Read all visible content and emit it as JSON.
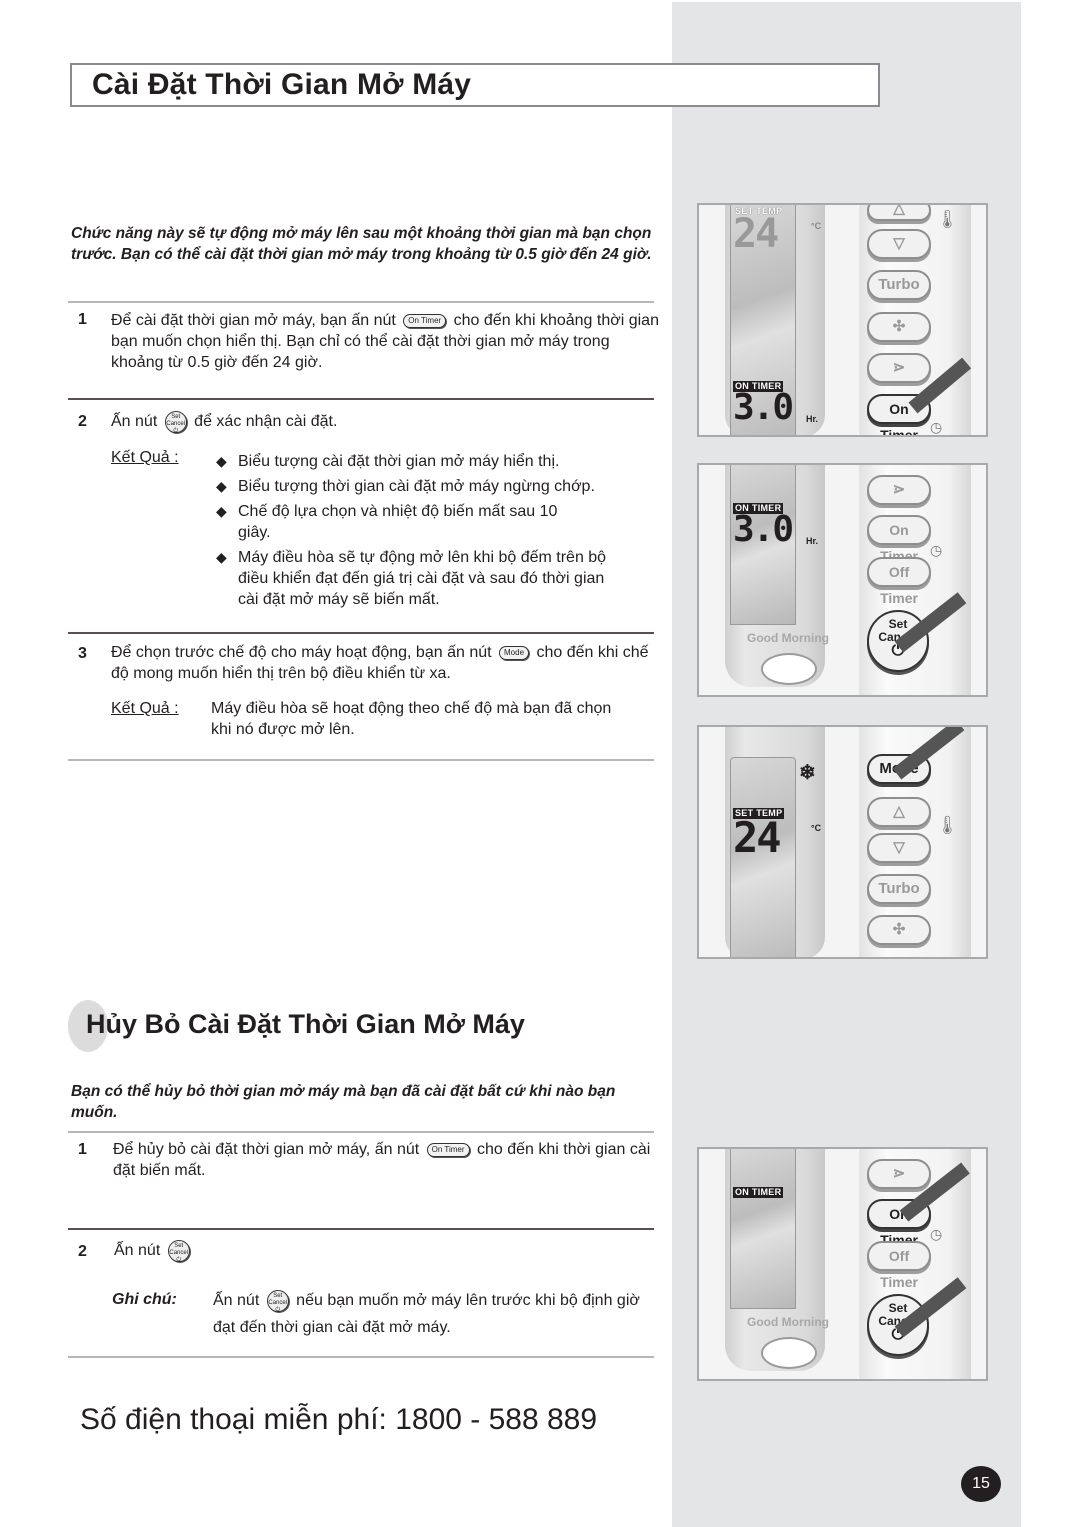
{
  "page": {
    "title": "Cài Đặt Thời Gian Mở Máy",
    "intro": "Chức năng này sẽ tự động mở máy lên sau một khoảng thời gian mà bạn chọn trước. Bạn có thể cài đặt thời gian mở máy trong khoảng từ 0.5 giờ đến 24 giờ.",
    "result_label": "Kết Quả",
    "result_colon": " :",
    "steps": [
      {
        "num": "1",
        "text_before": "Để cài đặt thời gian mở máy, bạn ấn nút",
        "button": "On Timer",
        "text_after": "cho đến khi khoảng thời gian bạn muốn chọn hiển thị. Bạn chỉ có thể cài đặt thời gian mở máy trong khoảng từ 0.5 giờ đến 24 giờ."
      },
      {
        "num": "2",
        "text_before": "Ấn nút",
        "button": "Set Cancel",
        "text_after": "để xác nhận cài đặt.",
        "results": [
          "Biểu tượng cài đặt thời gian mở máy hiển thị.",
          "Biểu tượng thời gian cài đặt mở máy ngừng chớp.",
          "Chế độ lựa chọn và nhiệt độ biến mất sau 10 giây.",
          "Máy điều hòa sẽ tự động mở lên khi bộ đếm trên bộ điều khiển đạt đến giá trị cài đặt và sau đó thời gian cài đặt mở máy sẽ biến mất."
        ]
      },
      {
        "num": "3",
        "text_before": "Để chọn trước chế độ cho máy hoạt động, bạn ấn nút",
        "button": "Mode",
        "text_after": "cho đến khi chế độ mong muốn hiển thị trên bộ điều khiển từ xa.",
        "result": "Máy điều hòa sẽ hoạt động theo chế độ mà bạn đã chọn khi nó được mở lên."
      }
    ]
  },
  "cancel_section": {
    "title": "Hủy Bỏ Cài Đặt Thời Gian Mở Máy",
    "intro": "Bạn có thể hủy bỏ thời gian mở máy mà bạn đã cài đặt bất cứ khi nào bạn muốn.",
    "steps": [
      {
        "num": "1",
        "text_before": "Để hủy bỏ cài đặt thời gian mở máy, ấn nút",
        "button": "On Timer",
        "text_after": "cho đến khi thời gian cài đặt biến mất."
      },
      {
        "num": "2",
        "text_before": "Ấn nút",
        "button": "Set Cancel"
      }
    ],
    "note_label": "Ghi chú:",
    "note_before": "Ấn nút",
    "note_button": "Set Cancel",
    "note_after": "nếu bạn muốn mở máy lên trước khi bộ định giờ đạt đến thời gian cài đặt mở máy."
  },
  "footer": {
    "phone": "Số điện thoại miễn phí: 1800 - 588 889",
    "page_number": "15"
  },
  "remotes": [
    {
      "lcd_top_label": "SET TEMP",
      "lcd_top_value": "24",
      "lcd_top_unit": "°C",
      "lcd_bottom_label": "ON TIMER",
      "lcd_bottom_value": "3.0",
      "lcd_bottom_unit": "Hr.",
      "buttons": [
        "△",
        "▽",
        "Turbo",
        "fan",
        "swing",
        "On Timer"
      ],
      "pressed": "On Timer"
    },
    {
      "lcd_label": "ON TIMER",
      "lcd_value": "3.0",
      "lcd_unit": "Hr.",
      "good_morning": "Good Morning",
      "buttons": [
        "swing",
        "On Timer",
        "Off Timer",
        "Set Cancel"
      ],
      "pressed": "Set Cancel"
    },
    {
      "mode_icon": "snowflake",
      "lcd_label": "SET TEMP",
      "lcd_value": "24",
      "lcd_unit": "°C",
      "buttons": [
        "Mode",
        "△",
        "▽",
        "Turbo",
        "fan"
      ],
      "pressed": "Mode"
    },
    {
      "lcd_label": "ON TIMER",
      "good_morning": "Good Morning",
      "buttons": [
        "swing",
        "On Timer",
        "Off Timer",
        "Set Cancel"
      ],
      "pressed": [
        "On Timer",
        "Set Cancel"
      ]
    }
  ],
  "colors": {
    "sidebar": "#e4e5e7",
    "text": "#231f20",
    "page_badge": "#231f20"
  }
}
